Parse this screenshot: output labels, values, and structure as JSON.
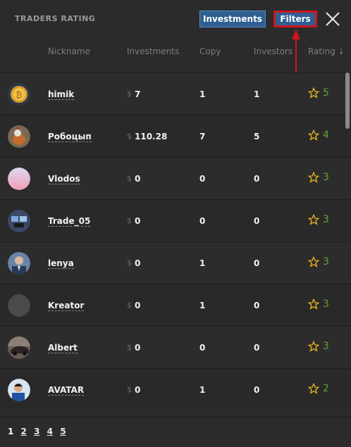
{
  "header": {
    "title": "TRADERS RATING",
    "investments_button": "Investments",
    "filters_button": "Filters"
  },
  "columns": {
    "nickname": "Nickname",
    "investments": "Investments",
    "copy": "Copy",
    "investors": "Investors",
    "rating": "Rating",
    "rating_sort": "↓"
  },
  "currency": "$",
  "rows": [
    {
      "nick": "himik",
      "investments": "7",
      "copy": "1",
      "investors": "1",
      "rating": "5",
      "avatar": "gold-coin"
    },
    {
      "nick": "Робоцып",
      "investments": "110.28",
      "copy": "7",
      "investors": "5",
      "rating": "4",
      "avatar": "rooster"
    },
    {
      "nick": "Vlodos",
      "investments": "0",
      "copy": "0",
      "investors": "0",
      "rating": "3",
      "avatar": "pink-gradient"
    },
    {
      "nick": "Trade_05",
      "investments": "0",
      "copy": "0",
      "investors": "0",
      "rating": "3",
      "avatar": "monitors"
    },
    {
      "nick": "lenya",
      "investments": "0",
      "copy": "1",
      "investors": "0",
      "rating": "3",
      "avatar": "man-portrait"
    },
    {
      "nick": "Kreator",
      "investments": "0",
      "copy": "1",
      "investors": "0",
      "rating": "3",
      "avatar": "gray-circle"
    },
    {
      "nick": "Albert",
      "investments": "0",
      "copy": "0",
      "investors": "0",
      "rating": "3",
      "avatar": "car"
    },
    {
      "nick": "AVATAR",
      "investments": "0",
      "copy": "1",
      "investors": "0",
      "rating": "2",
      "avatar": "person-blue"
    }
  ],
  "pagination": [
    "1",
    "2",
    "3",
    "4",
    "5"
  ],
  "colors": {
    "accent": "#2f5f92",
    "highlight": "#d0141b",
    "rating": "#62a33a",
    "star": "#e8b320"
  }
}
